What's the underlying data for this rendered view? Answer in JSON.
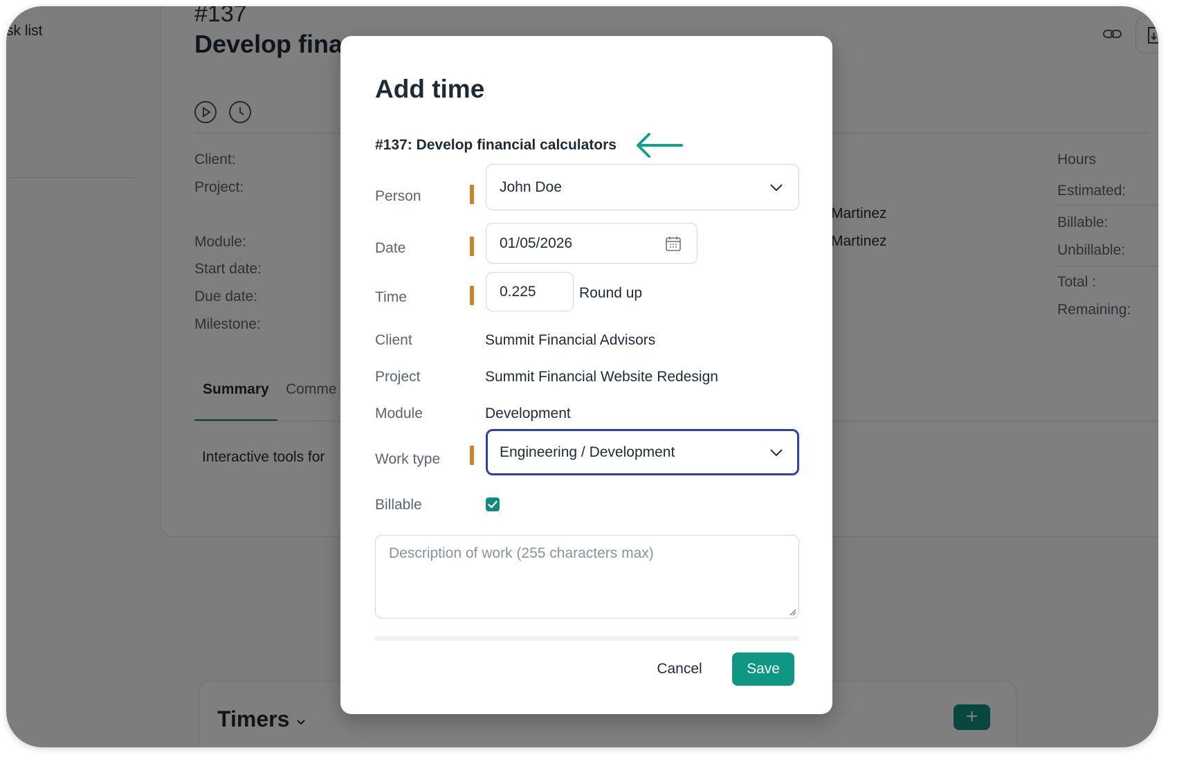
{
  "background": {
    "sidebar_link": "sk list",
    "task_number": "#137",
    "task_title_partial": "Develop fina",
    "fields_left": [
      "Client:",
      "Project:",
      "Module:",
      "Start date:",
      "Due date:",
      "Milestone:"
    ],
    "assignees": [
      "Martinez",
      "Martinez"
    ],
    "hours_panel": {
      "title": "Hours",
      "rows": [
        "Estimated:",
        "Billable:",
        "Unbillable:",
        "Total :",
        "Remaining:"
      ]
    },
    "tabs": [
      "Summary",
      "Comme"
    ],
    "summary_text": "Interactive tools for",
    "timers_label": "Timers",
    "add_label": "+"
  },
  "modal": {
    "title": "Add time",
    "task_ref": "#137: Develop financial calculators",
    "person": {
      "label": "Person",
      "value": "John Doe"
    },
    "date": {
      "label": "Date",
      "value": "01/05/2026"
    },
    "time": {
      "label": "Time",
      "value": "0.225",
      "round_up": "Round up"
    },
    "client": {
      "label": "Client",
      "value": "Summit Financial Advisors"
    },
    "project": {
      "label": "Project",
      "value": "Summit Financial Website Redesign"
    },
    "module": {
      "label": "Module",
      "value": "Development"
    },
    "work_type": {
      "label": "Work type",
      "value": "Engineering / Development"
    },
    "billable": {
      "label": "Billable",
      "checked": true
    },
    "description": {
      "placeholder": "Description of work (255 characters max)"
    },
    "cancel_label": "Cancel",
    "save_label": "Save"
  },
  "colors": {
    "accent": "#0f9684",
    "required_marker": "#c8862b",
    "focus_border": "#2f3fa8",
    "arrow": "#14a08f"
  }
}
